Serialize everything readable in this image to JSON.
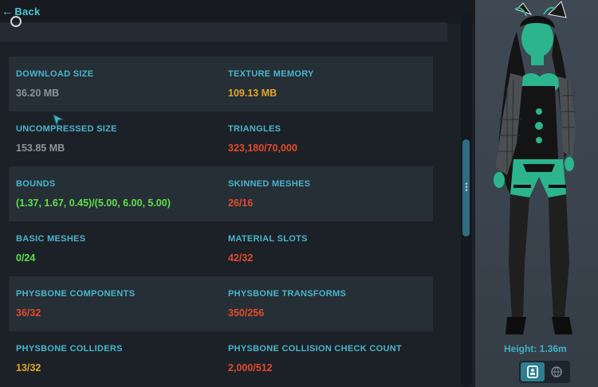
{
  "nav": {
    "back_label": "Back"
  },
  "stats": [
    {
      "label": "DOWNLOAD SIZE",
      "value": "36.20 MB",
      "color": "#8b949c"
    },
    {
      "label": "TEXTURE MEMORY",
      "value": "109.13 MB",
      "color": "#e2a52b"
    },
    {
      "label": "UNCOMPRESSED SIZE",
      "value": "153.85 MB",
      "color": "#8b949c"
    },
    {
      "label": "TRIANGLES",
      "value": "323,180/70,000",
      "color": "#e24a2c"
    },
    {
      "label": "BOUNDS",
      "value": "(1.37, 1.67, 0.45)/(5.00, 6.00, 5.00)",
      "color": "#5ee04a"
    },
    {
      "label": "SKINNED MESHES",
      "value": "26/16",
      "color": "#e24a2c"
    },
    {
      "label": "BASIC MESHES",
      "value": "0/24",
      "color": "#5ee04a"
    },
    {
      "label": "MATERIAL SLOTS",
      "value": "42/32",
      "color": "#e24a2c"
    },
    {
      "label": "PHYSBONE COMPONENTS",
      "value": "36/32",
      "color": "#e24a2c"
    },
    {
      "label": "PHYSBONE TRANSFORMS",
      "value": "350/256",
      "color": "#e24a2c"
    },
    {
      "label": "PHYSBONE COLLIDERS",
      "value": "13/32",
      "color": "#e2a52b"
    },
    {
      "label": "PHYSBONE COLLISION CHECK COUNT",
      "value": "2,000/512",
      "color": "#e24a2c"
    }
  ],
  "preview": {
    "height_label": "Height: 1.36m",
    "toggle_icons": [
      "avatar-card-icon",
      "globe-icon"
    ],
    "active_toggle": 0
  },
  "colors": {
    "accent": "#49b6cc",
    "good": "#5ee04a",
    "warn": "#e2a52b",
    "bad": "#e24a2c",
    "neutral": "#8b949c"
  }
}
